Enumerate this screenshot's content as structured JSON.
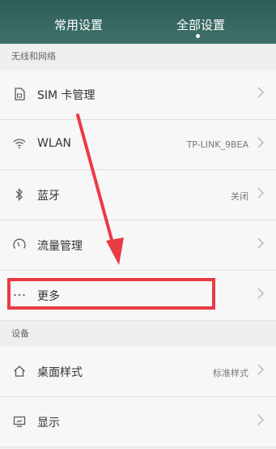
{
  "status_bar": {
    "left_text": "",
    "right_text": ""
  },
  "tabs": {
    "common": "常用设置",
    "all": "全部设置"
  },
  "sections": {
    "wireless": "无线和网络",
    "device": "设备"
  },
  "rows": {
    "sim": {
      "label": "SIM 卡管理",
      "icon": "sim-card-icon"
    },
    "wlan": {
      "label": "WLAN",
      "value": "TP-LINK_9BEA",
      "icon": "wifi-icon"
    },
    "bluetooth": {
      "label": "蓝牙",
      "value": "关闭",
      "icon": "bluetooth-icon"
    },
    "data": {
      "label": "流量管理",
      "icon": "data-usage-icon"
    },
    "more": {
      "label": "更多",
      "icon": "more-dots-icon"
    },
    "desktop": {
      "label": "桌面样式",
      "value": "标准样式",
      "icon": "home-icon"
    },
    "display": {
      "label": "显示",
      "icon": "display-icon"
    }
  },
  "annotation": {
    "color": "#ea3a44"
  }
}
